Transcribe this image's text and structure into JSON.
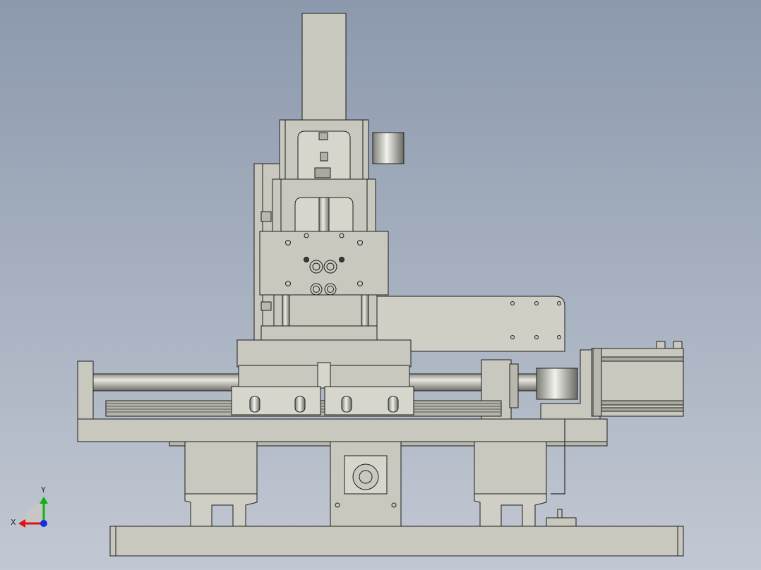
{
  "viewport": {
    "background_top": "#8c99ad",
    "background_bottom": "#c2c8d3",
    "part_fill": "#c8c8be",
    "part_fill_light": "#d6d6cc",
    "part_fill_dark": "#a9a9a0",
    "edge_color": "#1e1e1e"
  },
  "triad": {
    "x_label": "X",
    "y_label": "Y",
    "x_color": "#e01010",
    "y_color": "#10b010",
    "z_color": "#1030e0"
  }
}
